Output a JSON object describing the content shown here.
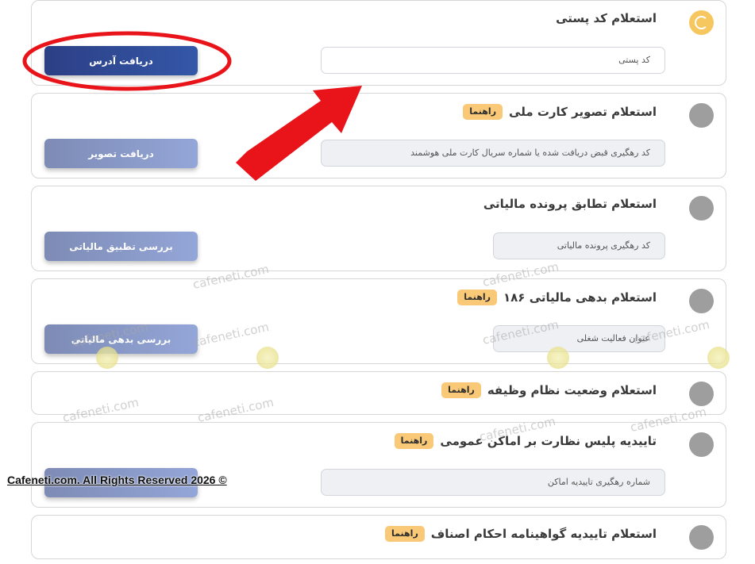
{
  "cards": [
    {
      "title": "استعلام کد پستی",
      "badge": "",
      "field": "کد پستی",
      "button": "دریافت آدرس"
    },
    {
      "title": "استعلام تصویر کارت ملی",
      "badge": "راهنما",
      "field": "کد رهگیری قبض دریافت شده یا شماره سریال کارت  ملی هوشمند",
      "button": "دریافت تصویر"
    },
    {
      "title": "استعلام تطابق پرونده مالیاتی",
      "badge": "",
      "field": "کد رهگیری پرونده مالیاتی",
      "button": "بررسی تطبیق مالیاتی"
    },
    {
      "title": "استعلام بدهی مالیاتی ۱۸۶",
      "badge": "راهنما",
      "field": "عنوان فعالیت شغلی",
      "button": "بررسی بدهی مالیاتی"
    },
    {
      "title": "استعلام وضعیت نظام وظیفه",
      "badge": "راهنما"
    },
    {
      "title": "تاییدیه پلیس نظارت بر اماکن عمومی",
      "badge": "راهنما",
      "field": "شماره رهگیری تاییدیه اماکن",
      "button": ""
    },
    {
      "title": "استعلام تاییدیه گواهینامه احکام اصناف",
      "badge": "راهنما"
    }
  ],
  "watermark": "cafeneti.com",
  "footer": "Cafeneti.com. All Rights Reserved 2026 ©",
  "colors": {
    "highlight": "#e8141a",
    "badge": "#f9c977",
    "active_step": "#f7c75f",
    "primary_button": "#2c3f85"
  }
}
